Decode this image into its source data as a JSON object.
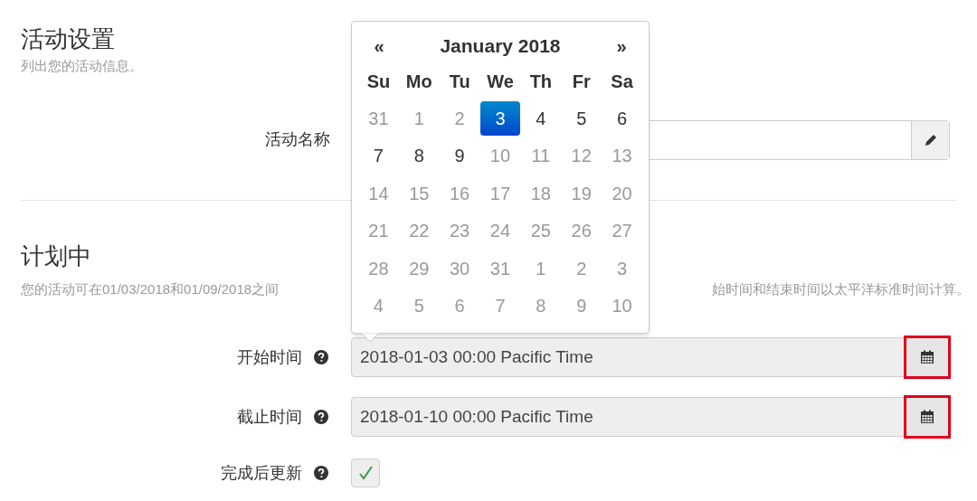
{
  "section_settings": {
    "title": "活动设置",
    "subtitle": "列出您的活动信息。",
    "name_field": {
      "label": "活动名称"
    }
  },
  "section_schedule": {
    "title": "计划中",
    "note_left": "您的活动可在01/03/2018和01/09/2018之间",
    "note_right": "始时间和结束时间以太平洋标准时间计算。",
    "start": {
      "label": "开始时间",
      "value": "2018-01-03 00:00 Pacific Time",
      "highlighted": true
    },
    "end": {
      "label": "截止时间",
      "value": "2018-01-10 00:00 Pacific Time",
      "highlighted": true
    },
    "update": {
      "label": "完成后更新",
      "checked": true
    }
  },
  "datepicker": {
    "prev": "«",
    "month": "January 2018",
    "next": "»",
    "weekdays": [
      "Su",
      "Mo",
      "Tu",
      "We",
      "Th",
      "Fr",
      "Sa"
    ],
    "weeks": [
      [
        {
          "day": "31",
          "disabled": true,
          "selected": false
        },
        {
          "day": "1",
          "disabled": true,
          "selected": false
        },
        {
          "day": "2",
          "disabled": true,
          "selected": false
        },
        {
          "day": "3",
          "disabled": false,
          "selected": true
        },
        {
          "day": "4",
          "disabled": false,
          "selected": false
        },
        {
          "day": "5",
          "disabled": false,
          "selected": false
        },
        {
          "day": "6",
          "disabled": false,
          "selected": false
        }
      ],
      [
        {
          "day": "7",
          "disabled": false,
          "selected": false
        },
        {
          "day": "8",
          "disabled": false,
          "selected": false
        },
        {
          "day": "9",
          "disabled": false,
          "selected": false
        },
        {
          "day": "10",
          "disabled": true,
          "selected": false
        },
        {
          "day": "11",
          "disabled": true,
          "selected": false
        },
        {
          "day": "12",
          "disabled": true,
          "selected": false
        },
        {
          "day": "13",
          "disabled": true,
          "selected": false
        }
      ],
      [
        {
          "day": "14",
          "disabled": true,
          "selected": false
        },
        {
          "day": "15",
          "disabled": true,
          "selected": false
        },
        {
          "day": "16",
          "disabled": true,
          "selected": false
        },
        {
          "day": "17",
          "disabled": true,
          "selected": false
        },
        {
          "day": "18",
          "disabled": true,
          "selected": false
        },
        {
          "day": "19",
          "disabled": true,
          "selected": false
        },
        {
          "day": "20",
          "disabled": true,
          "selected": false
        }
      ],
      [
        {
          "day": "21",
          "disabled": true,
          "selected": false
        },
        {
          "day": "22",
          "disabled": true,
          "selected": false
        },
        {
          "day": "23",
          "disabled": true,
          "selected": false
        },
        {
          "day": "24",
          "disabled": true,
          "selected": false
        },
        {
          "day": "25",
          "disabled": true,
          "selected": false
        },
        {
          "day": "26",
          "disabled": true,
          "selected": false
        },
        {
          "day": "27",
          "disabled": true,
          "selected": false
        }
      ],
      [
        {
          "day": "28",
          "disabled": true,
          "selected": false
        },
        {
          "day": "29",
          "disabled": true,
          "selected": false
        },
        {
          "day": "30",
          "disabled": true,
          "selected": false
        },
        {
          "day": "31",
          "disabled": true,
          "selected": false
        },
        {
          "day": "1",
          "disabled": true,
          "selected": false
        },
        {
          "day": "2",
          "disabled": true,
          "selected": false
        },
        {
          "day": "3",
          "disabled": true,
          "selected": false
        }
      ],
      [
        {
          "day": "4",
          "disabled": true,
          "selected": false
        },
        {
          "day": "5",
          "disabled": true,
          "selected": false
        },
        {
          "day": "6",
          "disabled": true,
          "selected": false
        },
        {
          "day": "7",
          "disabled": true,
          "selected": false
        },
        {
          "day": "8",
          "disabled": true,
          "selected": false
        },
        {
          "day": "9",
          "disabled": true,
          "selected": false
        },
        {
          "day": "10",
          "disabled": true,
          "selected": false
        }
      ]
    ]
  }
}
